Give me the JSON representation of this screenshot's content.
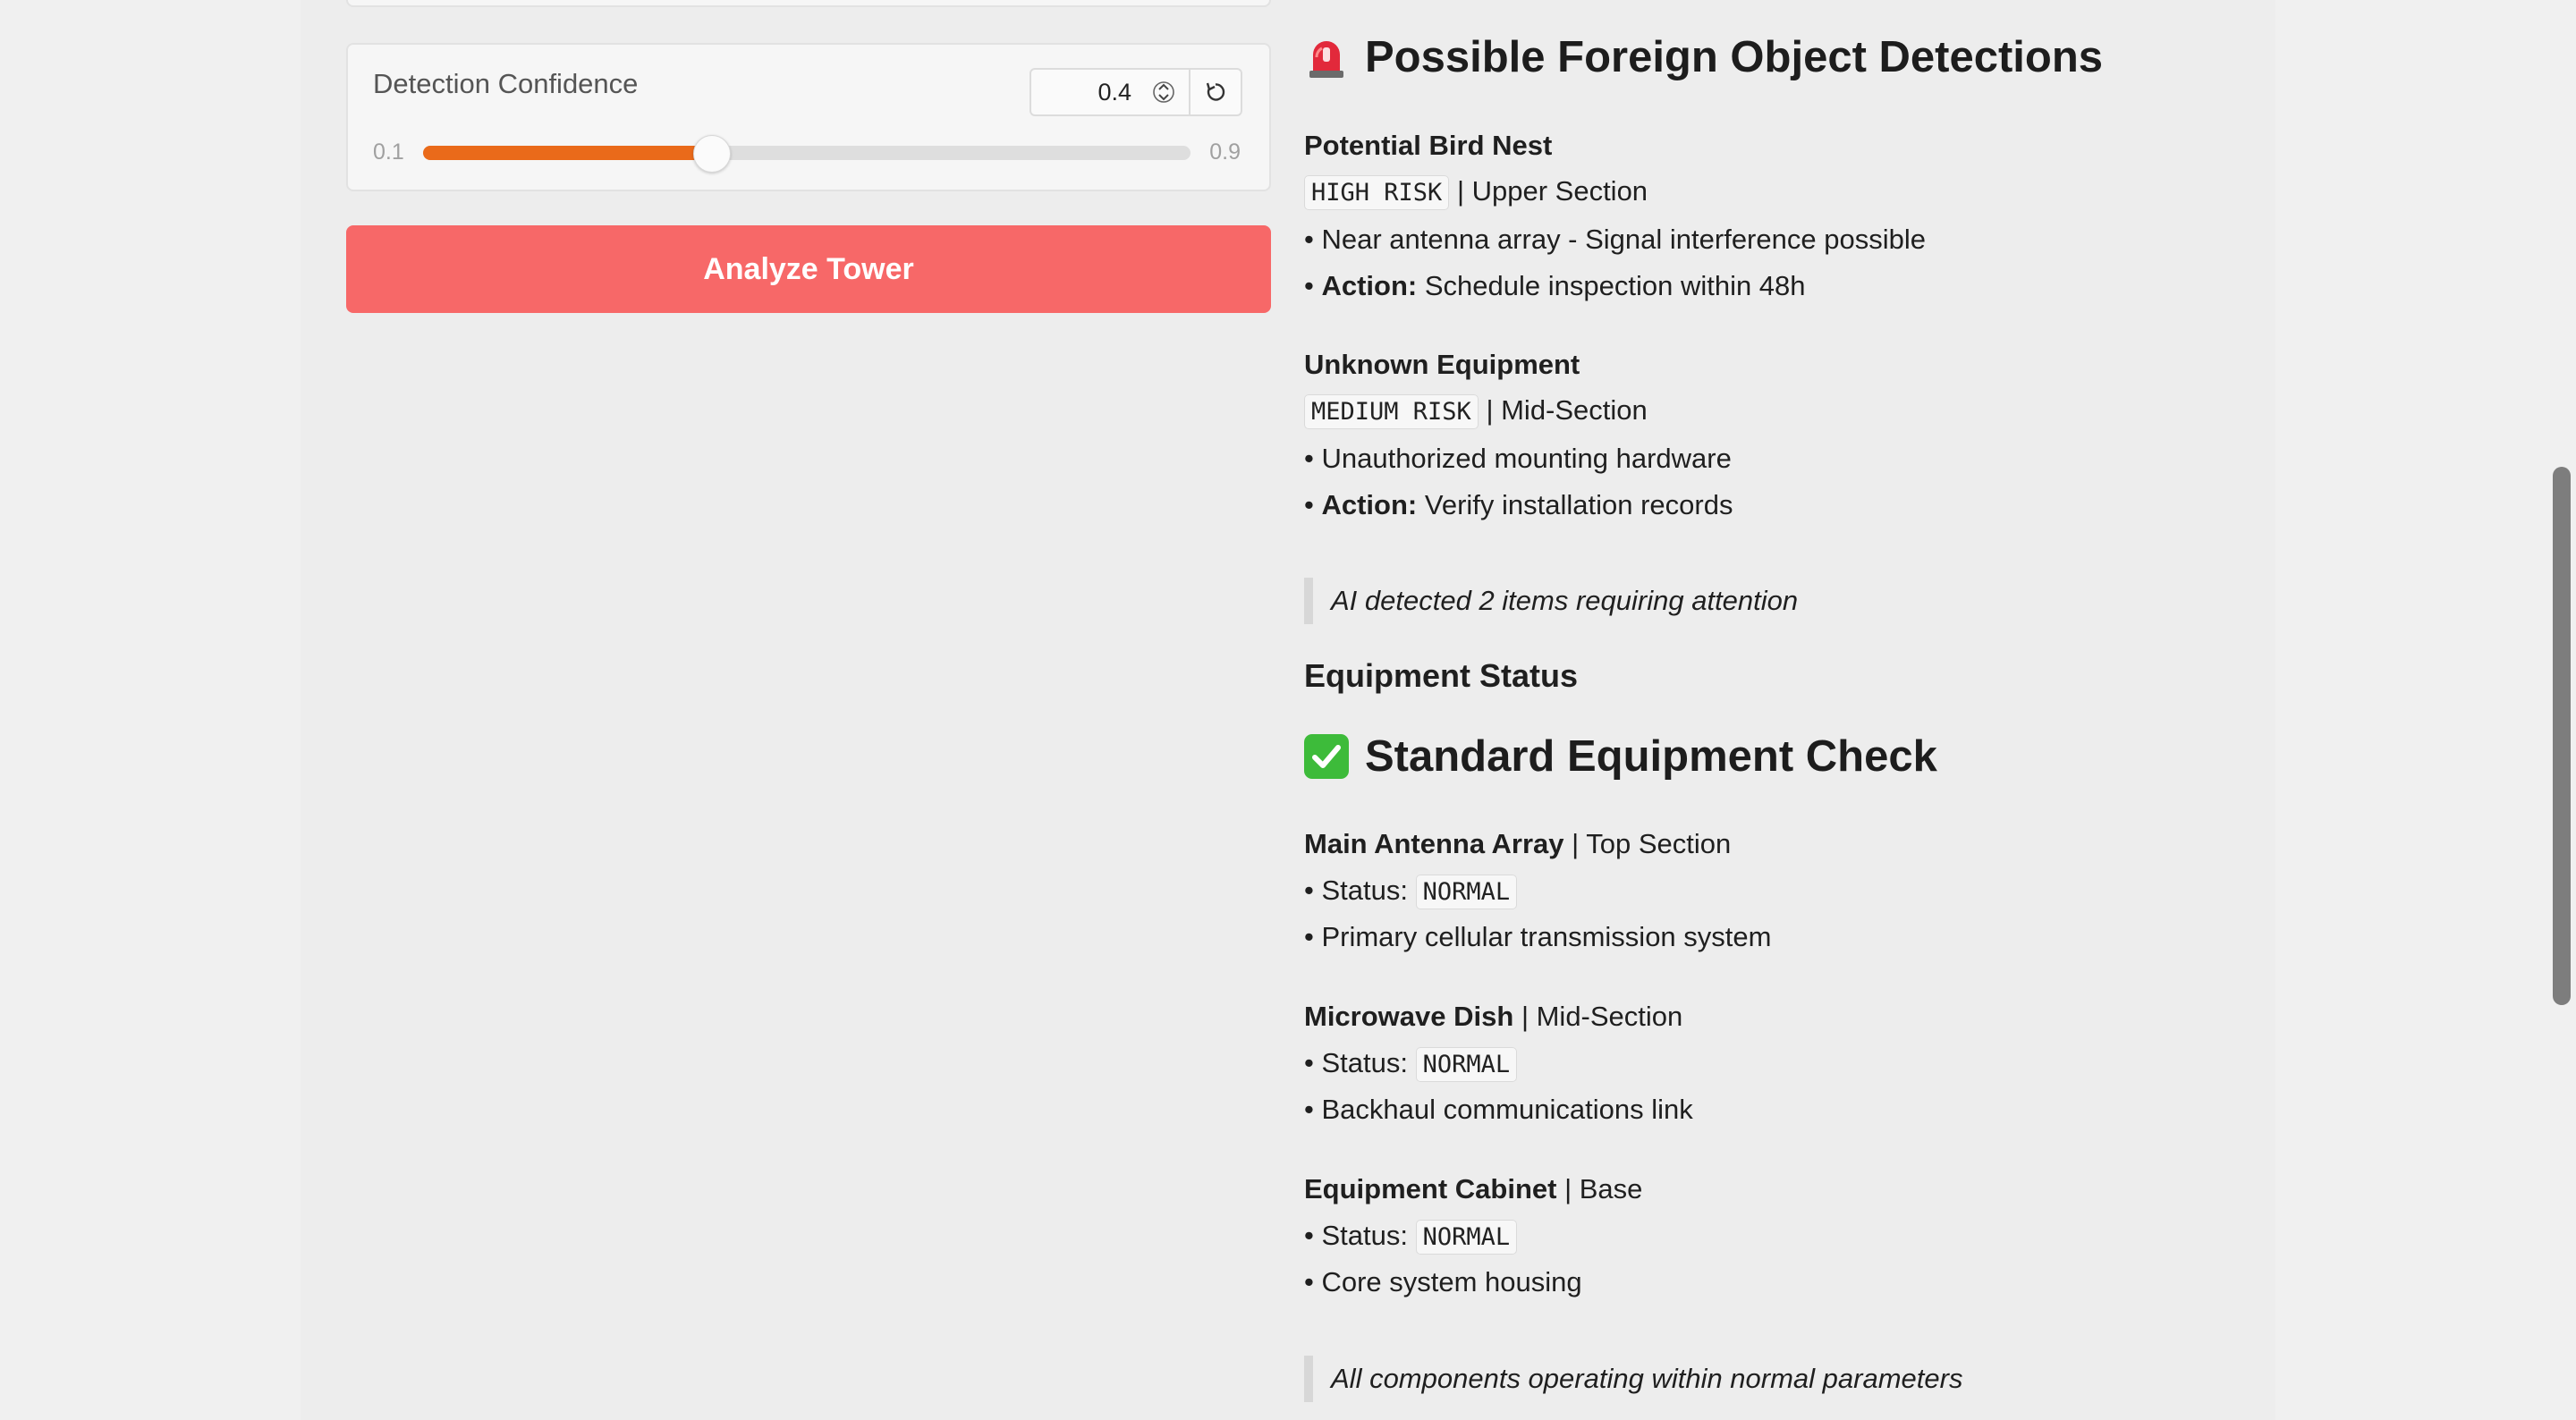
{
  "settings": {
    "confidence": {
      "label": "Detection Confidence",
      "value": "0.4",
      "min": "0.1",
      "max": "0.9",
      "fraction": 0.375
    },
    "analyze_label": "Analyze Tower",
    "accent_color": "#ea6a1a",
    "button_color": "#f76868"
  },
  "detections": {
    "title": "Possible Foreign Object Detections",
    "items": [
      {
        "name": "Potential Bird Nest",
        "risk": "HIGH RISK",
        "location": "| Upper Section",
        "detail": "• Near antenna array - Signal interference possible",
        "action_prefix": "• ",
        "action_label": "Action:",
        "action_text": "Schedule inspection within 48h"
      },
      {
        "name": "Unknown Equipment",
        "risk": "MEDIUM RISK",
        "location": "| Mid-Section",
        "detail": "• Unauthorized mounting hardware",
        "action_prefix": "• ",
        "action_label": "Action:",
        "action_text": "Verify installation records"
      }
    ],
    "summary": "AI detected 2 items requiring attention"
  },
  "equipment": {
    "section_title": "Equipment Status",
    "title": "Standard Equipment Check",
    "items": [
      {
        "name": "Main Antenna Array",
        "location": "| Top Section",
        "status_prefix": "• Status:",
        "status": "NORMAL",
        "desc": "• Primary cellular transmission system"
      },
      {
        "name": "Microwave Dish",
        "location": "| Mid-Section",
        "status_prefix": "• Status:",
        "status": "NORMAL",
        "desc": "• Backhaul communications link"
      },
      {
        "name": "Equipment Cabinet",
        "location": "| Base",
        "status_prefix": "• Status:",
        "status": "NORMAL",
        "desc": "• Core system housing"
      }
    ],
    "summary": "All components operating within normal parameters"
  },
  "icons": {
    "siren": "rotating-light-icon",
    "check": "check-mark-icon",
    "reset": "reset-icon",
    "spinner": "spinner-arrows-icon"
  }
}
